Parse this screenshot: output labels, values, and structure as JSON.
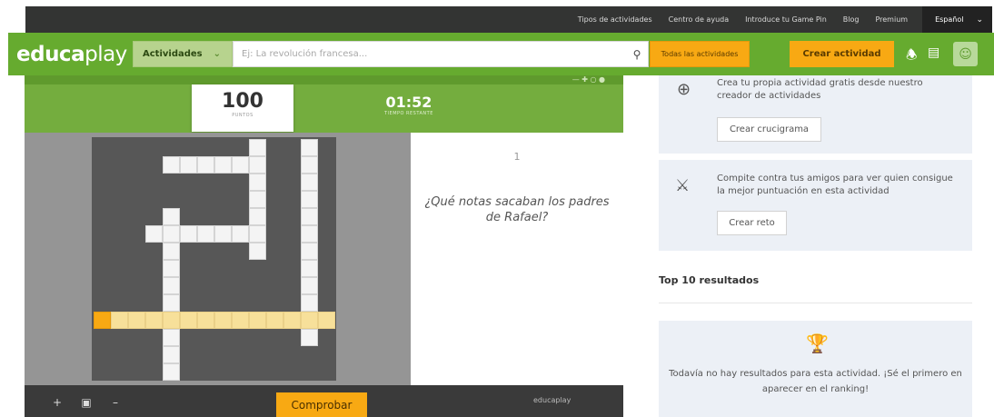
{
  "topbar": {
    "links": [
      "Tipos de actividades",
      "Centro de ayuda",
      "Introduce tu Game Pin",
      "Blog",
      "Premium"
    ],
    "language": "Español"
  },
  "header": {
    "logo_bold": "educa",
    "logo_thin": "play",
    "activities_dropdown": "Actividades",
    "search_placeholder": "Ej: La revolución francesa...",
    "all_activities_button": "Todas las actividades",
    "create_activity_button": "Crear actividad"
  },
  "game": {
    "score_value": "100",
    "score_label": "PUNTOS",
    "timer_value": "01:52",
    "timer_label": "TIEMPO RESTANTE",
    "clue_number": "1",
    "clue_text": "¿Qué notas sacaban los padres de Rafael?",
    "check_button": "Comprobar",
    "footer_logo": "educaplay"
  },
  "sidebar": {
    "create_card": {
      "text": "Crea tu propia actividad gratis desde nuestro creador de actividades",
      "button": "Crear crucigrama"
    },
    "challenge_card": {
      "text": "Compite contra tus amigos para ver quien consigue la mejor puntuación en esta actividad",
      "button": "Crear reto"
    },
    "top10_title": "Top 10 resultados",
    "empty_results": "Todavía no hay resultados para esta actividad. ¡Sé el primero en aparecer en el ranking!"
  },
  "colors": {
    "brand_green": "#66ab2f",
    "accent_orange": "#f8a913",
    "highlight_yellow": "#f7e09a"
  }
}
